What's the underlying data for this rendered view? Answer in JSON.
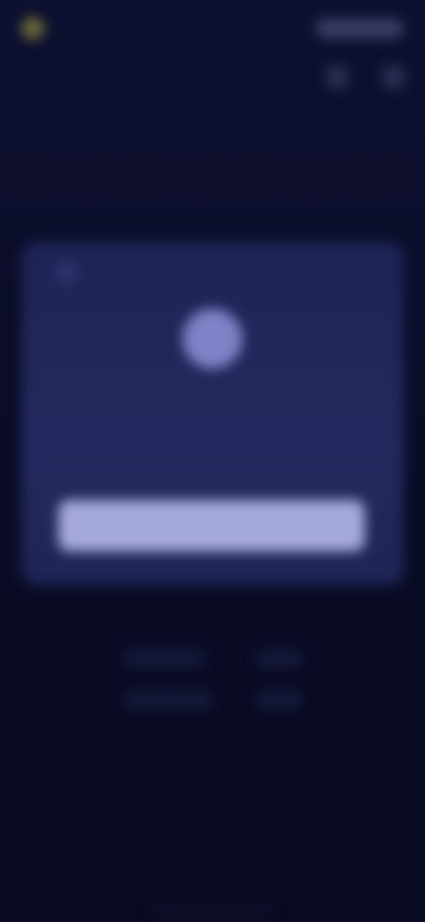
{
  "header": {
    "brand_name": "",
    "top_right_label": ""
  },
  "page": {
    "title": ""
  },
  "card": {
    "label": "",
    "subtitle": "",
    "primary_button_label": ""
  },
  "footer": {
    "links": [
      "",
      "",
      "",
      ""
    ]
  },
  "colors": {
    "background": "#0b0d24",
    "card": "#1f255a",
    "accent": "#a6a9de",
    "avatar": "#7e82c6",
    "brand": "#6b6a3a"
  }
}
